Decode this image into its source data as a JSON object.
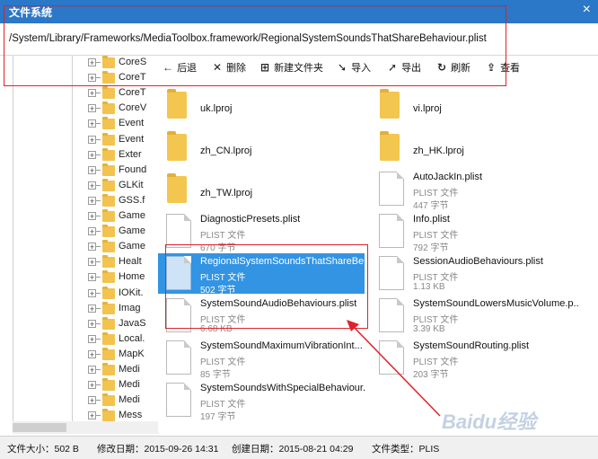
{
  "window": {
    "title": "文件系统",
    "close_label": "×"
  },
  "path": "/System/Library/Frameworks/MediaToolbox.framework/RegionalSystemSoundsThatShareBehaviour.plist",
  "toolbar": [
    {
      "label": "后退",
      "icon": "back-arrow-icon",
      "glyph": "←"
    },
    {
      "label": "删除",
      "icon": "delete-x-icon",
      "glyph": "✕"
    },
    {
      "label": "新建文件夹",
      "icon": "new-folder-icon",
      "glyph": "⊞"
    },
    {
      "label": "导入",
      "icon": "import-icon",
      "glyph": "➘"
    },
    {
      "label": "导出",
      "icon": "export-icon",
      "glyph": "➚"
    },
    {
      "label": "刷新",
      "icon": "refresh-icon",
      "glyph": "↻"
    },
    {
      "label": "查看",
      "icon": "view-icon",
      "glyph": "⇪"
    }
  ],
  "tree": [
    {
      "label": "CoreS"
    },
    {
      "label": "CoreT"
    },
    {
      "label": "CoreT"
    },
    {
      "label": "CoreV"
    },
    {
      "label": "Event"
    },
    {
      "label": "Event"
    },
    {
      "label": "Exter"
    },
    {
      "label": "Found"
    },
    {
      "label": "GLKit"
    },
    {
      "label": "GSS.f"
    },
    {
      "label": "Game"
    },
    {
      "label": "Game"
    },
    {
      "label": "Game"
    },
    {
      "label": "Healt"
    },
    {
      "label": "Home"
    },
    {
      "label": "IOKit."
    },
    {
      "label": "Imag"
    },
    {
      "label": "JavaS"
    },
    {
      "label": "Local."
    },
    {
      "label": "MapK"
    },
    {
      "label": "Medi"
    },
    {
      "label": "Medi"
    },
    {
      "label": "Medi"
    },
    {
      "label": "Mess"
    }
  ],
  "files": [
    {
      "name": "uk.lproj",
      "kind": "folder"
    },
    {
      "name": "vi.lproj",
      "kind": "folder"
    },
    {
      "name": "zh_CN.lproj",
      "kind": "folder"
    },
    {
      "name": "zh_HK.lproj",
      "kind": "folder"
    },
    {
      "name": "zh_TW.lproj",
      "kind": "folder"
    },
    {
      "name": "AutoJackIn.plist",
      "kind": "file",
      "type": "PLIST 文件",
      "size": "447 字节"
    },
    {
      "name": "DiagnosticPresets.plist",
      "kind": "file",
      "type": "PLIST 文件",
      "size": "670 字节"
    },
    {
      "name": "Info.plist",
      "kind": "file",
      "type": "PLIST 文件",
      "size": "792 字节"
    },
    {
      "name": "RegionalSystemSoundsThatShareBe...",
      "kind": "file",
      "type": "PLIST 文件",
      "size": "502 字节",
      "selected": true
    },
    {
      "name": "SessionAudioBehaviours.plist",
      "kind": "file",
      "type": "PLIST 文件",
      "size": "1.13 KB"
    },
    {
      "name": "SystemSoundAudioBehaviours.plist",
      "kind": "file",
      "type": "PLIST 文件",
      "size": "6.68 KB"
    },
    {
      "name": "SystemSoundLowersMusicVolume.p...",
      "kind": "file",
      "type": "PLIST 文件",
      "size": "3.39 KB"
    },
    {
      "name": "SystemSoundMaximumVibrationInt...",
      "kind": "file",
      "type": "PLIST 文件",
      "size": "85 字节"
    },
    {
      "name": "SystemSoundRouting.plist",
      "kind": "file",
      "type": "PLIST 文件",
      "size": "203 字节"
    },
    {
      "name": "SystemSoundsWithSpecialBehaviour...",
      "kind": "file",
      "type": "PLIST 文件",
      "size": "197 字节"
    }
  ],
  "status": {
    "size": "文件大小：502 B",
    "modified": "修改日期：2015-09-26 14:31",
    "created": "创建日期：2015-08-21 04:29",
    "type": "文件类型：PLIS"
  },
  "watermark": "Baidu经验",
  "colors": {
    "titlebar": "#2b77c8",
    "selection": "#3294e3",
    "annotation": "#e0212b",
    "folder": "#f3c64f"
  }
}
